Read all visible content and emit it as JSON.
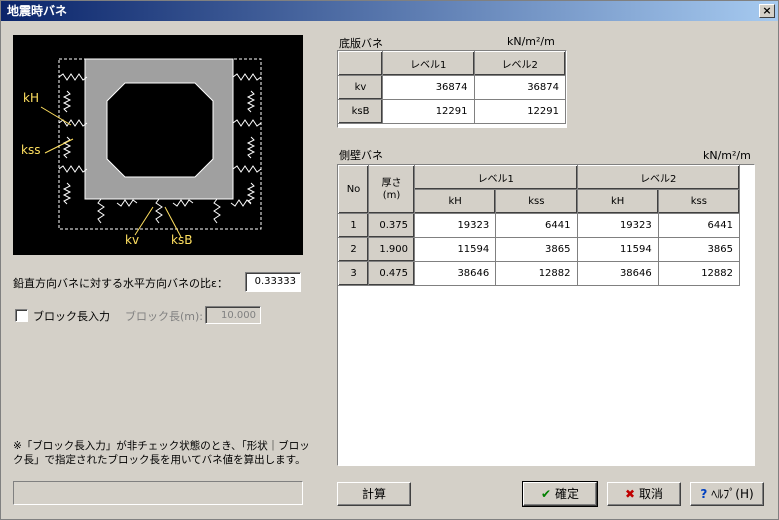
{
  "window": {
    "title": "地震時バネ",
    "close": "×"
  },
  "diagram": {
    "labels": {
      "kh": "kH",
      "kss": "kss",
      "kv": "kv",
      "ksb": "ksB"
    }
  },
  "ratio": {
    "label": "鉛直方向バネに対する水平方向バネの比ε：",
    "value": "0.33333"
  },
  "block": {
    "checkbox_label": "ブロック長入力",
    "length_label": "ブロック長(m):",
    "length_value": "10.000",
    "checked": false
  },
  "note": "※「ブロック長入力」が非チェック状態のとき、「形状｜ブロック長」で指定されたブロック長を用いてバネ値を算出します。",
  "bottom_slab": {
    "title": "底版バネ",
    "unit": "kN/m²/m",
    "columns": [
      "レベル1",
      "レベル2"
    ],
    "rows": [
      {
        "name": "kv",
        "level1": "36874",
        "level2": "36874"
      },
      {
        "name": "ksB",
        "level1": "12291",
        "level2": "12291"
      }
    ]
  },
  "side_wall": {
    "title": "側壁バネ",
    "unit": "kN/m²/m",
    "headers": {
      "no": "No",
      "thickness": "厚さ\n(m)",
      "level1": "レベル1",
      "level2": "レベル2",
      "kh": "kH",
      "kss": "kss"
    },
    "rows": [
      {
        "no": "1",
        "thickness": "0.375",
        "l1_kh": "19323",
        "l1_kss": "6441",
        "l2_kh": "19323",
        "l2_kss": "6441"
      },
      {
        "no": "2",
        "thickness": "1.900",
        "l1_kh": "11594",
        "l1_kss": "3865",
        "l2_kh": "11594",
        "l2_kss": "3865"
      },
      {
        "no": "3",
        "thickness": "0.475",
        "l1_kh": "38646",
        "l1_kss": "12882",
        "l2_kh": "38646",
        "l2_kss": "12882"
      }
    ]
  },
  "buttons": {
    "calc": "計算",
    "ok": "確定",
    "cancel": "取消",
    "help": "ﾍﾙﾌﾟ(H)"
  },
  "colors": {
    "title_start": "#0a246a",
    "title_end": "#a6caf0",
    "label_yellow": "#ffe060",
    "box_gray": "#a0a0a0"
  }
}
